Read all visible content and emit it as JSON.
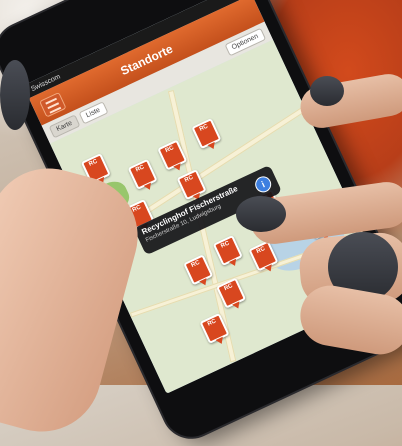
{
  "status_bar": {
    "carrier": "Swisscom",
    "time": "",
    "battery": ""
  },
  "app": {
    "title": "Standorte"
  },
  "toolbar": {
    "map_label": "Karte",
    "list_label": "Liste",
    "options_label": "Optionen"
  },
  "map": {
    "markers": [
      "RC",
      "RC",
      "RC",
      "RC",
      "RC",
      "RC",
      "RC",
      "RC",
      "RC",
      "RC",
      "RC",
      "RC",
      "RC"
    ],
    "callout": {
      "name": "Recyclinghof Fischerstraße",
      "address": "Fischerstraße 10, Ludwigsburg"
    }
  },
  "colors": {
    "nav": "#d0592a",
    "marker": "#d8471f",
    "callout": "#141418",
    "info_button": "#3d7fe0"
  }
}
